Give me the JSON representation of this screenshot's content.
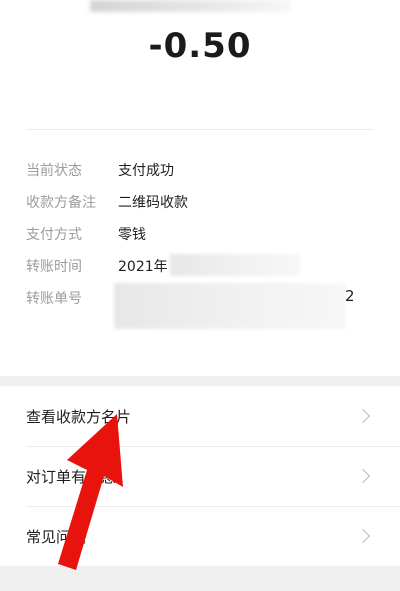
{
  "payment": {
    "amount": "-0.50"
  },
  "details": {
    "rows": [
      {
        "label": "当前状态",
        "value": "支付成功"
      },
      {
        "label": "收款方备注",
        "value": "二维码收款"
      },
      {
        "label": "支付方式",
        "value": "零钱"
      },
      {
        "label": "转账时间",
        "value": "2021年"
      },
      {
        "label": "转账单号",
        "value": "",
        "tail": "2"
      }
    ]
  },
  "menu": {
    "items": [
      {
        "label": "查看收款方名片"
      },
      {
        "label": "对订单有疑惑"
      },
      {
        "label": "常见问题"
      }
    ]
  },
  "annotation": {
    "arrow_color": "#e8130d"
  }
}
